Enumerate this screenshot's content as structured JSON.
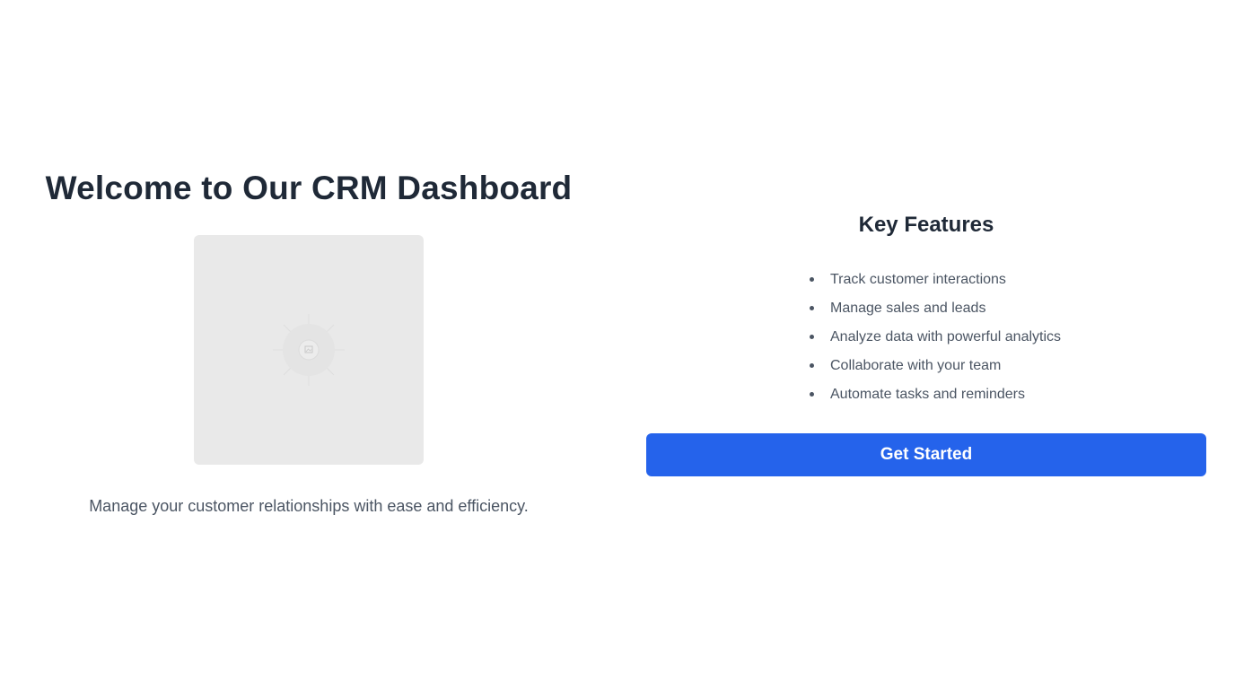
{
  "hero": {
    "title": "Welcome to Our CRM Dashboard",
    "image_icon": "image-placeholder-icon",
    "tagline": "Manage your customer relationships with ease and efficiency."
  },
  "features": {
    "title": "Key Features",
    "items": [
      "Track customer interactions",
      "Manage sales and leads",
      "Analyze data with powerful analytics",
      "Collaborate with your team",
      "Automate tasks and reminders"
    ]
  },
  "cta": {
    "label": "Get Started"
  },
  "colors": {
    "heading": "#1f2937",
    "body_text": "#4b5563",
    "accent": "#2563eb",
    "image_bg": "#e9e9e9",
    "background": "#ffffff"
  }
}
